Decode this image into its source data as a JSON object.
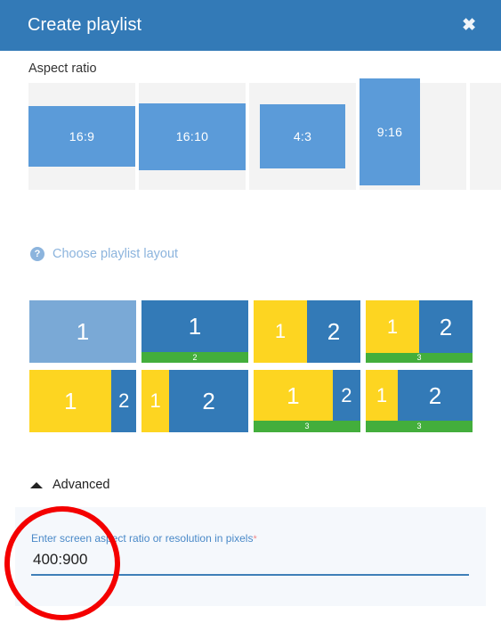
{
  "dialog": {
    "title": "Create playlist",
    "close_label": "✖"
  },
  "aspect_ratio": {
    "section_label": "Aspect ratio",
    "options": [
      {
        "label": "16:9",
        "shape": "landscape",
        "selected": false
      },
      {
        "label": "16:10",
        "shape": "landscape",
        "selected": false
      },
      {
        "label": "4:3",
        "shape": "landscape",
        "selected": false
      },
      {
        "label": "9:16",
        "shape": "portrait",
        "selected": false
      }
    ]
  },
  "help": {
    "icon": "question-mark-circle-icon",
    "icon_glyph": "?",
    "text": "Choose playlist layout",
    "color": "#8cb4dd"
  },
  "layouts": {
    "tiles": [
      {
        "id": 1,
        "zones": [
          "1"
        ],
        "bar": null,
        "highlighted": true
      },
      {
        "id": 2,
        "zones": [
          "1"
        ],
        "bar": "2",
        "highlighted": false
      },
      {
        "id": 3,
        "zones": [
          "1",
          "2"
        ],
        "bar": null,
        "highlighted": false
      },
      {
        "id": 4,
        "zones": [
          "1",
          "2"
        ],
        "bar": "3",
        "highlighted": false
      },
      {
        "id": 5,
        "zones": [
          "1",
          "2"
        ],
        "bar": null,
        "highlighted": false
      },
      {
        "id": 6,
        "zones": [
          "1",
          "2"
        ],
        "bar": null,
        "highlighted": false
      },
      {
        "id": 7,
        "zones": [
          "1",
          "2"
        ],
        "bar": "3",
        "highlighted": false
      },
      {
        "id": 8,
        "zones": [
          "1",
          "2"
        ],
        "bar": "3",
        "highlighted": false
      }
    ],
    "colors": {
      "zone_blue": "#337ab7",
      "zone_light_blue": "#7aa9d6",
      "zone_yellow": "#fdd521",
      "bar_green": "#43ae3c"
    }
  },
  "advanced": {
    "toggle_label": "Advanced",
    "expanded": true,
    "field_label": "Enter screen aspect ratio or resolution in pixels",
    "required_marker": "*",
    "field_value": "400:900",
    "field_placeholder": ""
  },
  "annotation": {
    "shape": "circle",
    "color": "#f40000"
  },
  "theme": {
    "header_blue": "#337ab7",
    "accent_blue": "#5b9bd9",
    "panel_bg": "#f5f8fc",
    "cell_bg": "#f3f3f3"
  }
}
